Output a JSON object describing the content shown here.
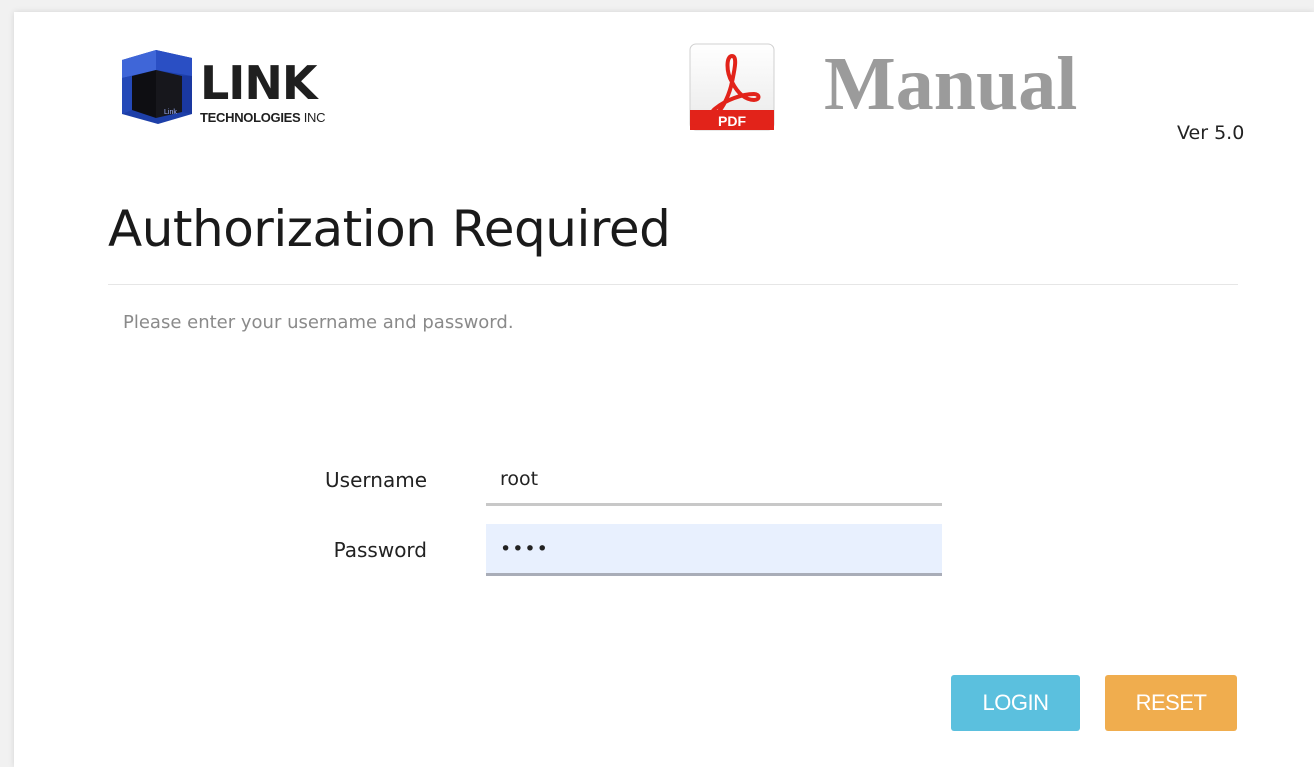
{
  "brand": {
    "name": "LINK",
    "sub_bold": "TECHNOLOGIES",
    "sub_light": "INC",
    "cube_caption": "Link"
  },
  "manual": {
    "pdf_badge": "PDF",
    "title": "Manual",
    "version": "Ver 5.0"
  },
  "auth": {
    "heading": "Authorization Required",
    "subtitle": "Please enter your username and password."
  },
  "form": {
    "username_label": "Username",
    "username_value": "root",
    "password_label": "Password",
    "password_value": "root"
  },
  "buttons": {
    "login_label": "LOGIN",
    "reset_label": "RESET"
  },
  "colors": {
    "login": "#5bc0de",
    "reset": "#f0ad4e",
    "manual_title": "#9b9b9b",
    "autofill_bg": "#e8f0fe",
    "pdf_red": "#e2231a"
  }
}
